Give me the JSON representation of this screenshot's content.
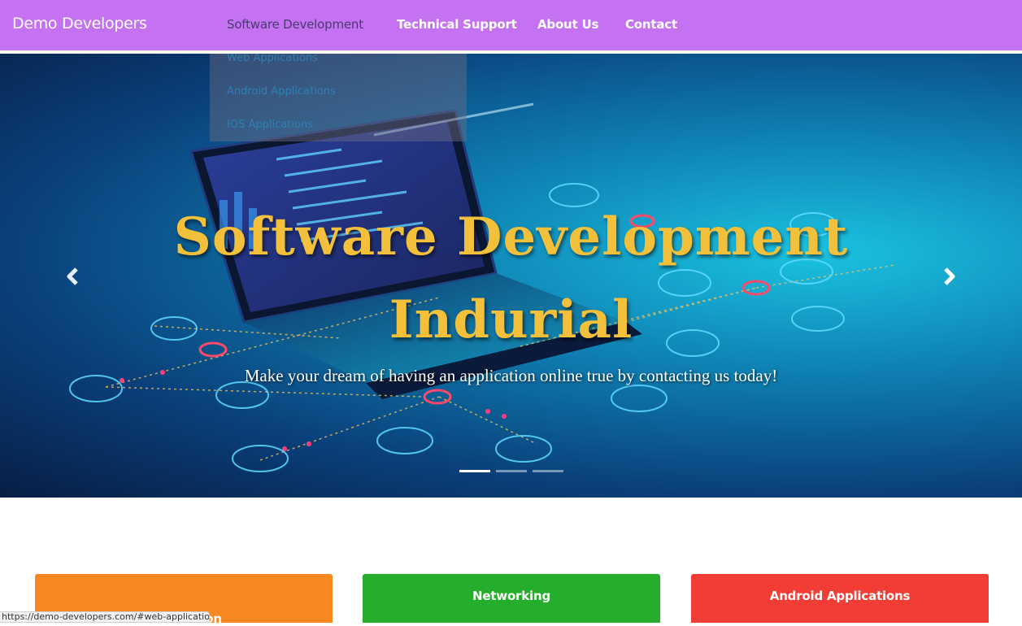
{
  "navbar": {
    "brand": "Demo Developers",
    "items": [
      {
        "label": "Software Development"
      },
      {
        "label": "Technical Support"
      },
      {
        "label": "About Us"
      },
      {
        "label": "Contact"
      }
    ],
    "background": "#c472f2"
  },
  "dropdown": {
    "items": [
      {
        "label": "Web Applications"
      },
      {
        "label": "Android Applications"
      },
      {
        "label": "IOS Applications"
      }
    ]
  },
  "hero": {
    "title_line1": "Software Development",
    "title_line2": "Indurial",
    "subtitle": "Make your dream of having an application online true by contacting us today!",
    "prev_icon": "chevron-left-icon",
    "next_icon": "chevron-right-icon",
    "slide_count": 3,
    "active_slide": 1,
    "title_color": "#f2c03a"
  },
  "cards": [
    {
      "title": "Application",
      "color": "#f88920"
    },
    {
      "title": "Networking",
      "color": "#25ae2b"
    },
    {
      "title": "Android Applications",
      "color": "#f23d36"
    }
  ],
  "statusbar": {
    "text": "https://demo-developers.com/#web-applications"
  }
}
